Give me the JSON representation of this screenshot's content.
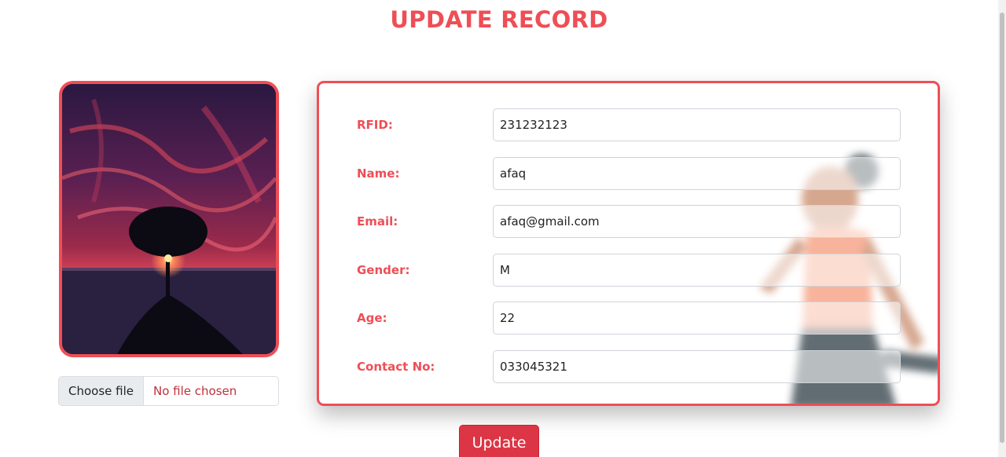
{
  "page": {
    "title": "UPDATE RECORD"
  },
  "file_input": {
    "button_label": "Choose file",
    "status": "No file chosen"
  },
  "form": {
    "fields": [
      {
        "label": "RFID:",
        "value": "231232123"
      },
      {
        "label": "Name:",
        "value": "afaq"
      },
      {
        "label": "Email:",
        "value": "afaq@gmail.com"
      },
      {
        "label": "Gender:",
        "value": "M"
      },
      {
        "label": "Age:",
        "value": "22"
      },
      {
        "label": "Contact No:",
        "value": "033045321"
      }
    ],
    "submit_label": "Update"
  },
  "colors": {
    "accent": "#ef4e56",
    "button": "#dc3545"
  }
}
